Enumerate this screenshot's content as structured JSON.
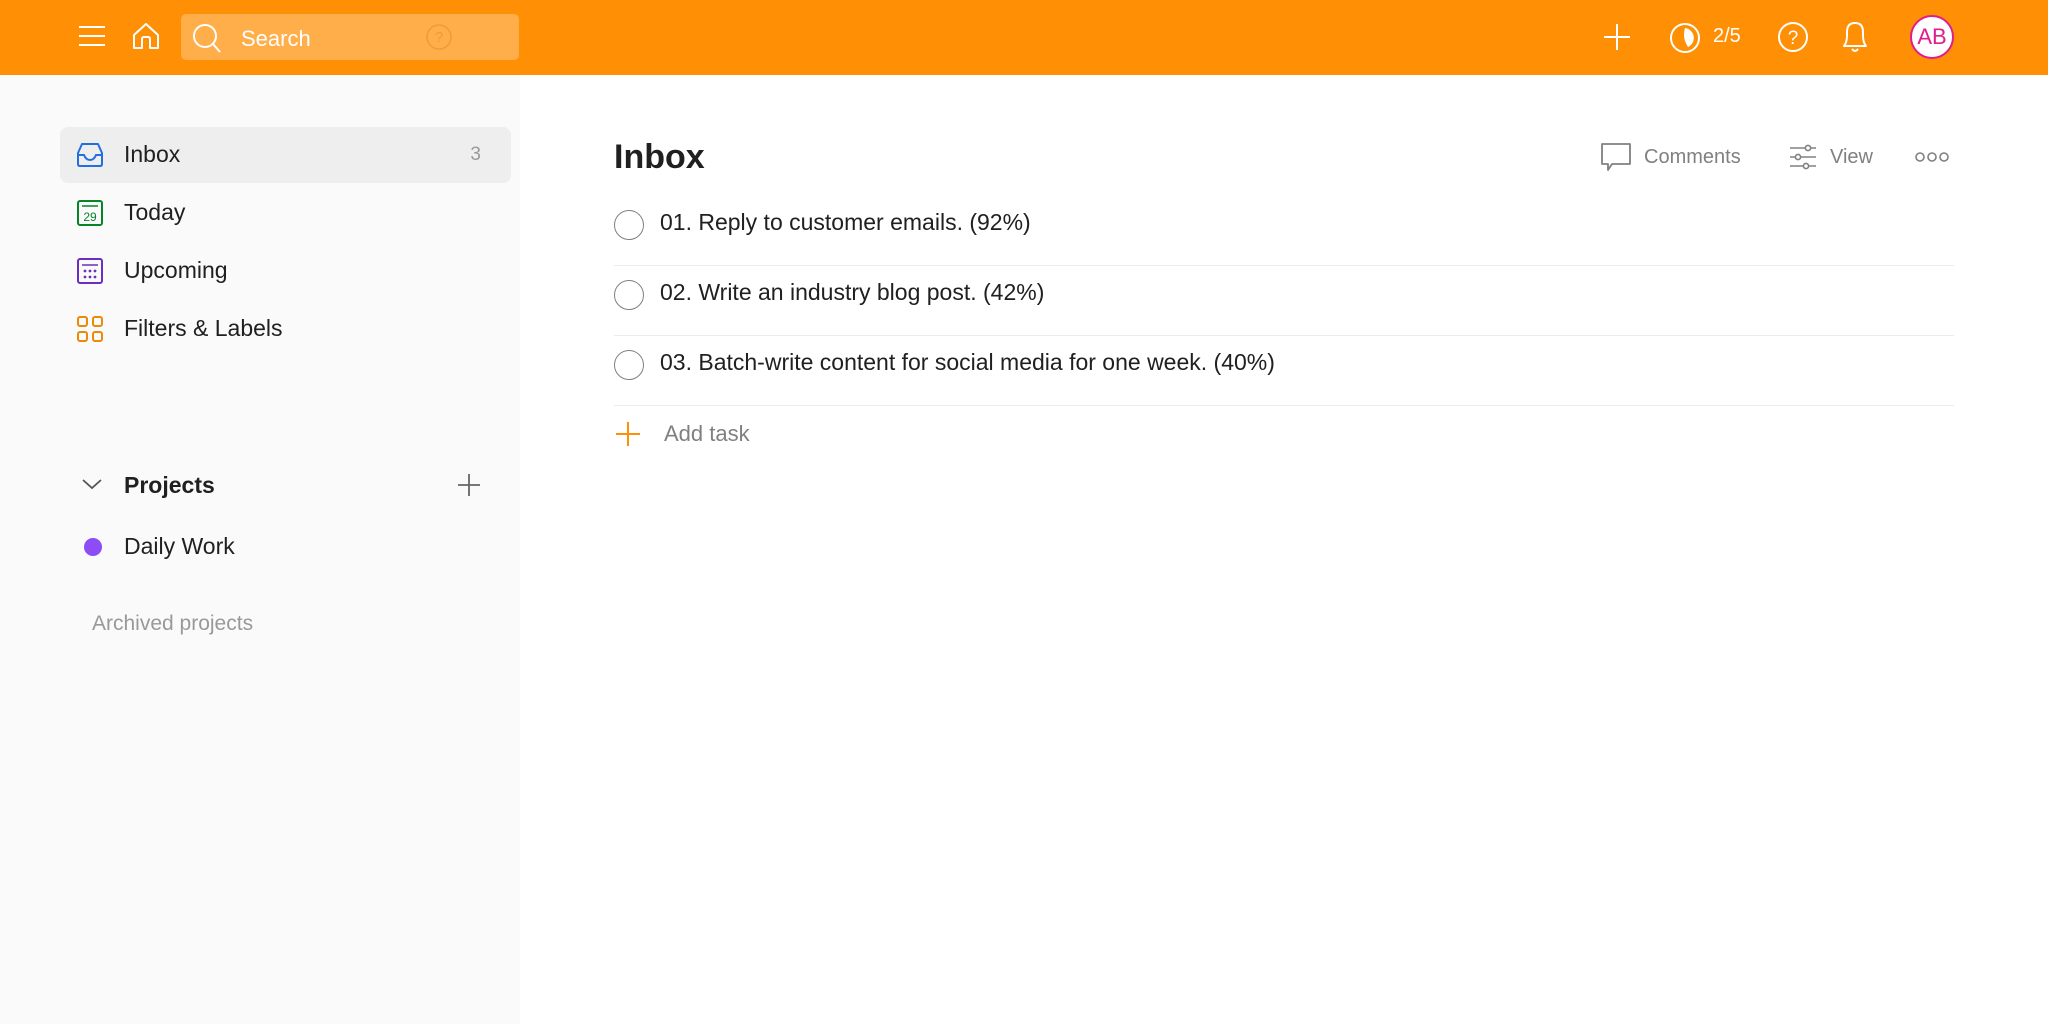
{
  "topbar": {
    "search_placeholder": "Search",
    "karma": "2/5",
    "avatar_initials": "AB",
    "accent_color": "#ff8f04"
  },
  "sidebar": {
    "items": [
      {
        "label": "Inbox",
        "count": "3",
        "icon": "inbox-icon",
        "color": "#246fe0"
      },
      {
        "label": "Today",
        "icon": "calendar-today-icon",
        "day": "29",
        "color": "#058527"
      },
      {
        "label": "Upcoming",
        "icon": "calendar-upcoming-icon",
        "color": "#692fc2"
      },
      {
        "label": "Filters & Labels",
        "icon": "filters-labels-icon",
        "color": "#eb8909"
      }
    ],
    "projects_title": "Projects",
    "projects": [
      {
        "label": "Daily Work",
        "color": "#8c4cf7"
      }
    ],
    "archived_label": "Archived projects"
  },
  "main": {
    "title": "Inbox",
    "comments_label": "Comments",
    "view_label": "View",
    "tasks": [
      {
        "text": "01. Reply to customer emails. (92%)"
      },
      {
        "text": "02. Write an industry blog post. (42%)"
      },
      {
        "text": "03. Batch-write content for social media for one week. (40%)"
      }
    ],
    "add_task_label": "Add task"
  }
}
